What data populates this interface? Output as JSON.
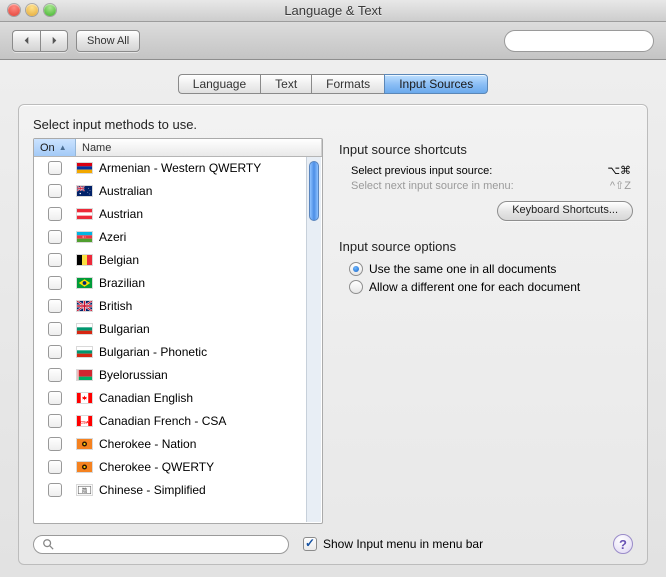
{
  "window": {
    "title": "Language & Text"
  },
  "toolbar": {
    "show_all": "Show All",
    "search_placeholder": ""
  },
  "tabs": [
    {
      "label": "Language",
      "selected": false
    },
    {
      "label": "Text",
      "selected": false
    },
    {
      "label": "Formats",
      "selected": false
    },
    {
      "label": "Input Sources",
      "selected": true
    }
  ],
  "panel": {
    "instruction": "Select input methods to use.",
    "columns": {
      "on": "On",
      "name": "Name"
    },
    "rows": [
      {
        "name": "Armenian - Western QWERTY",
        "flag": "am"
      },
      {
        "name": "Australian",
        "flag": "au"
      },
      {
        "name": "Austrian",
        "flag": "at"
      },
      {
        "name": "Azeri",
        "flag": "az"
      },
      {
        "name": "Belgian",
        "flag": "be"
      },
      {
        "name": "Brazilian",
        "flag": "br"
      },
      {
        "name": "British",
        "flag": "gb"
      },
      {
        "name": "Bulgarian",
        "flag": "bg"
      },
      {
        "name": "Bulgarian - Phonetic",
        "flag": "bg"
      },
      {
        "name": "Byelorussian",
        "flag": "by"
      },
      {
        "name": "Canadian English",
        "flag": "ca"
      },
      {
        "name": "Canadian French - CSA",
        "flag": "ca_csa"
      },
      {
        "name": "Cherokee - Nation",
        "flag": "chr"
      },
      {
        "name": "Cherokee - QWERTY",
        "flag": "chr"
      },
      {
        "name": "Chinese - Simplified",
        "flag": "cn_ime"
      }
    ],
    "shortcuts": {
      "heading": "Input source shortcuts",
      "prev_label": "Select previous input source:",
      "prev_key": "⌥⌘",
      "next_label": "Select next input source in menu:",
      "next_key": "^⇧Z",
      "button": "Keyboard Shortcuts..."
    },
    "options": {
      "heading": "Input source options",
      "same": "Use the same one in all documents",
      "diff": "Allow a different one for each document"
    },
    "footer": {
      "show_menu": "Show Input menu in menu bar"
    }
  }
}
